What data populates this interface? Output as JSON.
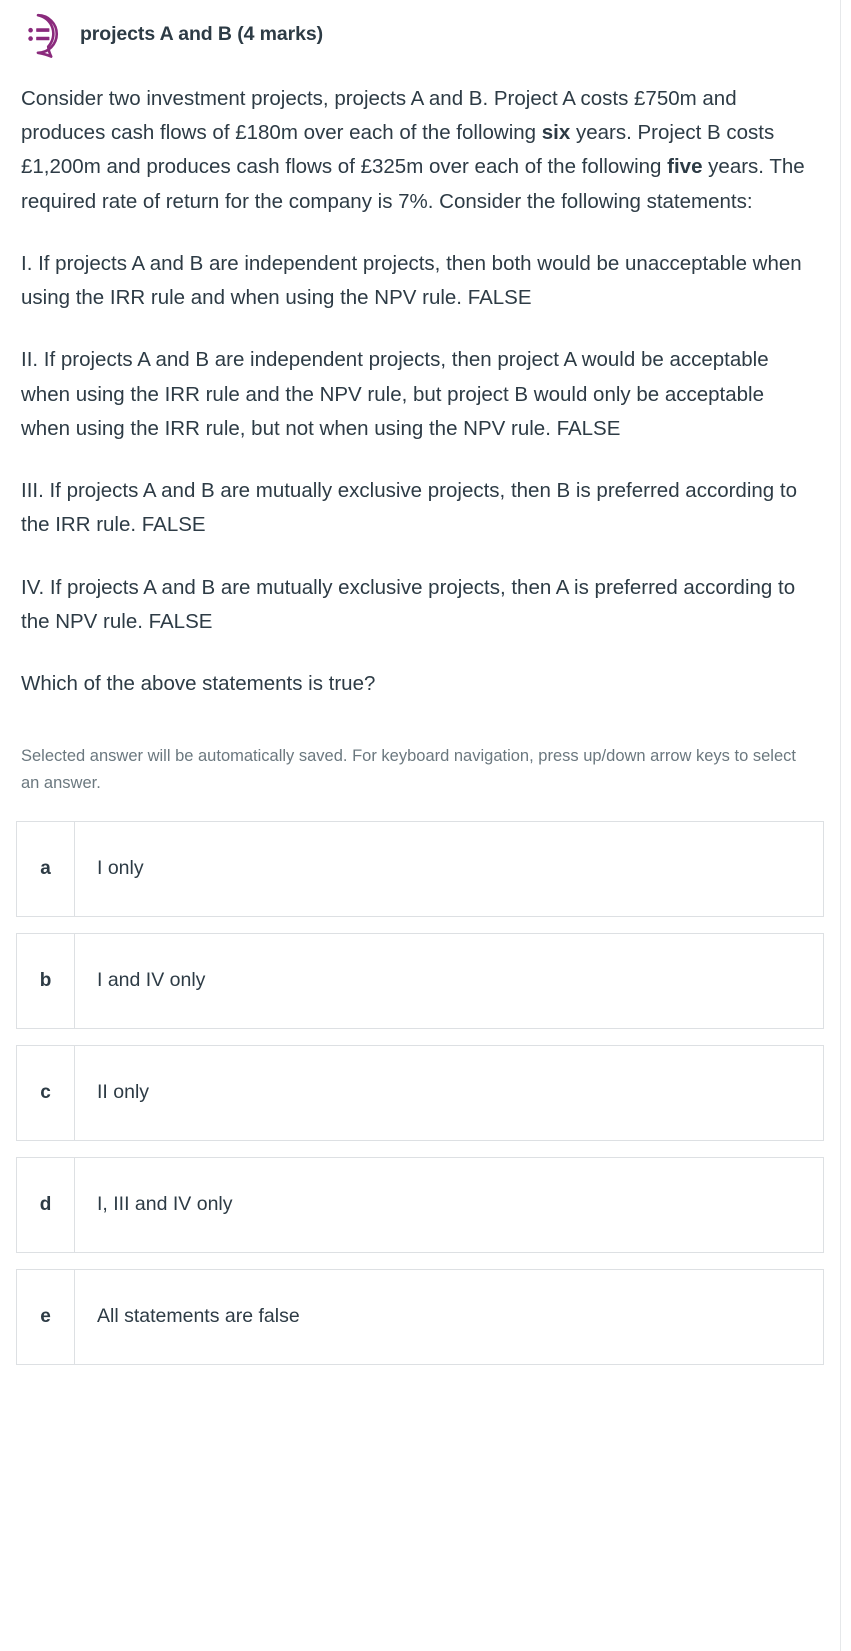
{
  "header": {
    "icon": "multichoice-question-icon",
    "icon_color": "#8a2a7c",
    "icon_fill": "#f7ecf5",
    "title": "projects A and B (4 marks)"
  },
  "question": {
    "intro": "Consider two investment projects, projects A and B. Project A costs £750m and produces cash flows of £180m over each of the following ",
    "intro_bold_1": "six",
    "intro_mid": " years. Project B costs £1,200m and produces cash flows of £325m over each of the following ",
    "intro_bold_2": "five",
    "intro_end": " years. The required rate of return for the company is 7%. Consider the following statements:",
    "statements": [
      "I. If projects A and B are independent projects, then both would be unacceptable when using the IRR rule and when using the NPV rule. FALSE",
      "II. If projects A and B are independent projects, then project A would be acceptable when using the IRR rule and the NPV rule, but project B would only be acceptable when using the IRR rule, but not when using the NPV rule. FALSE",
      "III. If projects A and B are mutually exclusive projects, then B is preferred according to the IRR rule. FALSE",
      "IV. If projects A and B are mutually exclusive projects, then A is preferred according to the NPV rule. FALSE"
    ],
    "prompt": "Which of the above statements is true?"
  },
  "hint": "Selected answer will be automatically saved. For keyboard navigation, press up/down arrow keys to select an answer.",
  "answers": [
    {
      "letter": "a",
      "text": "I only"
    },
    {
      "letter": "b",
      "text": "I and IV only"
    },
    {
      "letter": "c",
      "text": "II only"
    },
    {
      "letter": "d",
      "text": "I, III and IV only"
    },
    {
      "letter": "e",
      "text": "All statements are false"
    }
  ],
  "colors": {
    "text": "#2d3b45",
    "muted": "#6b787f",
    "border": "#dde0e3",
    "accent": "#8a2a7c"
  }
}
